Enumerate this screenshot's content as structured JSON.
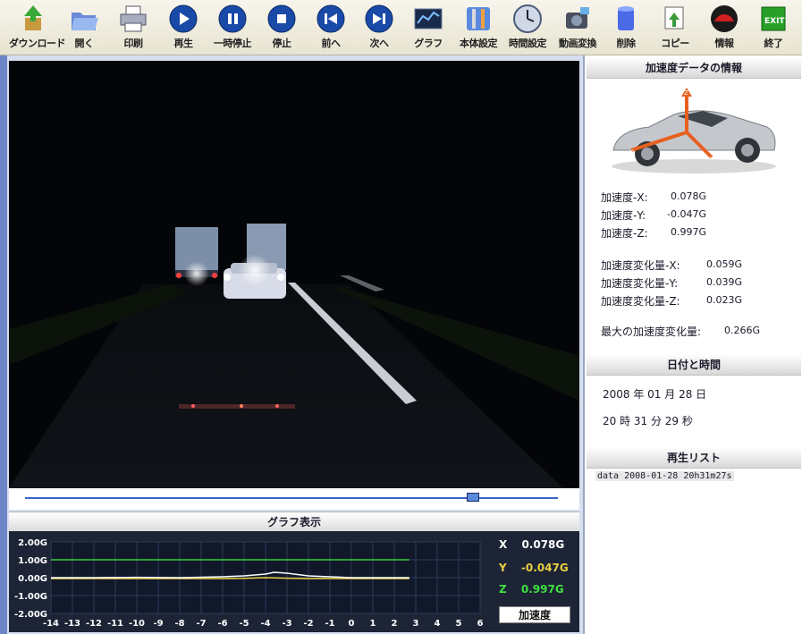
{
  "toolbar": {
    "buttons": [
      {
        "label": "ダウンロード",
        "icon": "download-icon"
      },
      {
        "label": "開く",
        "icon": "folder-open-icon"
      },
      {
        "label": "印刷",
        "icon": "printer-icon"
      },
      {
        "label": "再生",
        "icon": "play-icon"
      },
      {
        "label": "一時停止",
        "icon": "pause-icon"
      },
      {
        "label": "停止",
        "icon": "stop-icon"
      },
      {
        "label": "前へ",
        "icon": "previous-icon"
      },
      {
        "label": "次へ",
        "icon": "next-icon"
      },
      {
        "label": "グラフ",
        "icon": "graph-icon"
      },
      {
        "label": "本体設定",
        "icon": "settings-icon"
      },
      {
        "label": "時間設定",
        "icon": "clock-icon"
      },
      {
        "label": "動画変換",
        "icon": "camera-convert-icon"
      },
      {
        "label": "削除",
        "icon": "trash-icon"
      },
      {
        "label": "コピー",
        "icon": "copy-icon"
      },
      {
        "label": "情報",
        "icon": "info-car-icon"
      },
      {
        "label": "終了",
        "icon": "exit-icon"
      }
    ]
  },
  "seekbar": {
    "position": 0.84
  },
  "graph": {
    "title": "グラフ表示",
    "readouts": [
      {
        "axis": "X",
        "value": "0.078G",
        "color": "#ffffff"
      },
      {
        "axis": "Y",
        "value": "-0.047G",
        "color": "#e8d040"
      },
      {
        "axis": "Z",
        "value": "0.997G",
        "color": "#40e040"
      }
    ],
    "mode_button": "加速度"
  },
  "chart_data": {
    "type": "line",
    "title": "",
    "xlabel": "",
    "ylabel": "",
    "x_ticks": [
      "-14",
      "-13",
      "-12",
      "-11",
      "-10",
      "-9",
      "-8",
      "-7",
      "-6",
      "-5",
      "-4",
      "-3",
      "-2",
      "-1",
      "0",
      "1",
      "2",
      "3",
      "4",
      "5",
      "6"
    ],
    "y_ticks": [
      "2.00G",
      "1.00G",
      "0.00G",
      "-1.00G",
      "-2.00G"
    ],
    "xlim": [
      -14,
      6
    ],
    "ylim": [
      -2,
      2
    ],
    "grid": true,
    "series": [
      {
        "color": "#3ccc3c",
        "x": [
          -14,
          -12,
          -10,
          -8,
          -6,
          -4,
          -2,
          0,
          2,
          2.7
        ],
        "y": [
          1.0,
          1.0,
          1.0,
          1.0,
          1.0,
          1.0,
          1.0,
          1.0,
          1.0,
          1.0
        ]
      },
      {
        "color": "#e8d040",
        "x": [
          -14,
          -12,
          -10,
          -8,
          -6,
          -5,
          -4,
          -3,
          -2,
          -1,
          0,
          1,
          2,
          2.7
        ],
        "y": [
          -0.05,
          -0.05,
          -0.05,
          -0.05,
          -0.05,
          -0.04,
          0.0,
          -0.03,
          -0.05,
          -0.05,
          -0.05,
          -0.05,
          -0.05,
          -0.05
        ]
      },
      {
        "color": "#ffffff",
        "x": [
          -14,
          -12,
          -10,
          -8,
          -6,
          -5,
          -4,
          -3.6,
          -3,
          -2,
          -1,
          0,
          1,
          2,
          2.7
        ],
        "y": [
          0.0,
          0.0,
          0.02,
          0.0,
          0.05,
          0.1,
          0.2,
          0.3,
          0.25,
          0.1,
          0.05,
          0.0,
          0.0,
          0.0,
          0.0
        ]
      }
    ]
  },
  "accel_info": {
    "title": "加速度データの情報",
    "rows": [
      {
        "label": "加速度-X:",
        "value": "0.078G"
      },
      {
        "label": "加速度-Y:",
        "value": "-0.047G"
      },
      {
        "label": "加速度-Z:",
        "value": "0.997G"
      }
    ],
    "delta_rows": [
      {
        "label": "加速度変化量-X:",
        "value": "0.059G"
      },
      {
        "label": "加速度変化量-Y:",
        "value": "0.039G"
      },
      {
        "label": "加速度変化量-Z:",
        "value": "0.023G"
      }
    ],
    "max_label": "最大の加速度変化量:",
    "max_value": "0.266G"
  },
  "datetime": {
    "title": "日付と時間",
    "date": "2008 年  01 月  28 日",
    "time": "20 時  31 分  29 秒"
  },
  "playlist": {
    "title": "再生リスト",
    "items": [
      "data 2008-01-28 20h31m27s"
    ]
  }
}
